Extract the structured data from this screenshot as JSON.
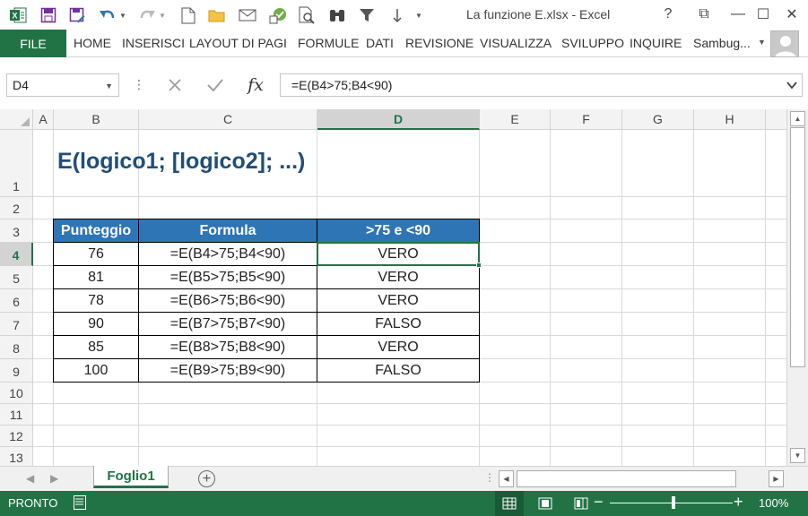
{
  "window": {
    "title": "La funzione E.xlsx - Excel",
    "controls": [
      "?",
      "⧉",
      "—",
      "☐",
      "✕"
    ]
  },
  "ribbon": {
    "file_label": "FILE",
    "tabs": [
      "HOME",
      "INSERISCI",
      "LAYOUT DI PAGI",
      "FORMULE",
      "DATI",
      "REVISIONE",
      "VISUALIZZA",
      "SVILUPPO",
      "INQUIRE"
    ],
    "account": "Sambug..."
  },
  "formula_bar": {
    "name_box": "D4",
    "formula": "=E(B4>75;B4<90)",
    "fx_label": "fx"
  },
  "columns": [
    "A",
    "B",
    "C",
    "D",
    "E",
    "F",
    "G",
    "H"
  ],
  "rows": [
    "1",
    "2",
    "3",
    "4",
    "5",
    "6",
    "7",
    "8",
    "9",
    "10",
    "11",
    "12",
    "13"
  ],
  "selected_cell": {
    "column": "D",
    "row": "4"
  },
  "sheet": {
    "heading": "E(logico1; [logico2]; ...)",
    "table": {
      "headers": [
        "Punteggio",
        "Formula",
        ">75 e <90"
      ],
      "rows": [
        [
          "76",
          "=E(B4>75;B4<90)",
          "VERO"
        ],
        [
          "81",
          "=E(B5>75;B5<90)",
          "VERO"
        ],
        [
          "78",
          "=E(B6>75;B6<90)",
          "VERO"
        ],
        [
          "90",
          "=E(B7>75;B7<90)",
          "FALSO"
        ],
        [
          "85",
          "=E(B8>75;B8<90)",
          "VERO"
        ],
        [
          "100",
          "=E(B9>75;B9<90)",
          "FALSO"
        ]
      ]
    }
  },
  "sheet_tabs": {
    "active": "Foglio1",
    "add_label": "+"
  },
  "status_bar": {
    "ready": "PRONTO",
    "zoom": "100%",
    "zoom_fraction": 0.5
  },
  "colors": {
    "excel_green": "#217346",
    "table_header": "#2e75b6",
    "heading_text": "#1f4e79"
  }
}
